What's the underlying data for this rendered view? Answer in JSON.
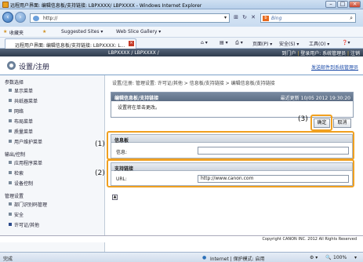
{
  "browser": {
    "title": "远程用户界面: 编辑信息板/支持链接: LBPXXXX/ LBPXXXX - Windows Internet Explorer",
    "url": "http://",
    "search_engine": "Bing",
    "favorites": "收藏夹",
    "suggested_sites": "Suggested Sites ▾",
    "web_slice": "Web Slice Gallery ▾",
    "tab_title": "远程用户界面: 编辑信息板/支持链接: LBPXXXX: L...",
    "menu_page": "页面(P) ▾",
    "menu_safety": "安全(S) ▾",
    "menu_tools": "工具(O) ▾",
    "menu_help": "❓▾"
  },
  "app": {
    "model": "LBPXXXX / LBPXXXX /",
    "to_portal": "到门户",
    "login_user": "登录用户: 系统管理员",
    "logout": "注销",
    "title": "设置/注册",
    "send_mail": "发送邮件到系统管理员"
  },
  "sidebar": {
    "groups": [
      {
        "label": "参数选择",
        "items": [
          "显示菜单",
          "共纸器菜单",
          "网络",
          "布局菜单",
          "质量菜单",
          "用户维护菜单"
        ]
      },
      {
        "label": "输出/控制",
        "items": [
          "应用程序菜单",
          "检索",
          "设备控制"
        ]
      },
      {
        "label": "管理设置",
        "items": [
          "部门识别码管理",
          "安全",
          "许可证/其他"
        ]
      }
    ]
  },
  "main": {
    "breadcrumb": "设置/注册: 管理设置: 许可证/其他 > 信息板/支持链接 > 编辑信息板/支持链接",
    "panel_title": "编辑信息板/支持链接",
    "last_updated": "最近更新 10/05 2012 19:30:20",
    "message": "设置将在单击更改。",
    "ok": "确定",
    "cancel": "取消",
    "callout3": "(3)",
    "callout1": "(1)",
    "callout2": "(2)",
    "sec1_title": "信息板",
    "sec1_label": "信息:",
    "sec1_value": "",
    "sec2_title": "支持链接",
    "sec2_label": "URL:",
    "sec2_value": "http://www.canon.com",
    "copyright": "Copyright CANON INC. 2012 All Rights Reserved"
  },
  "status": {
    "left": "完成",
    "zone": "Internet | 保护模式: 启用",
    "zoom": "100%"
  }
}
